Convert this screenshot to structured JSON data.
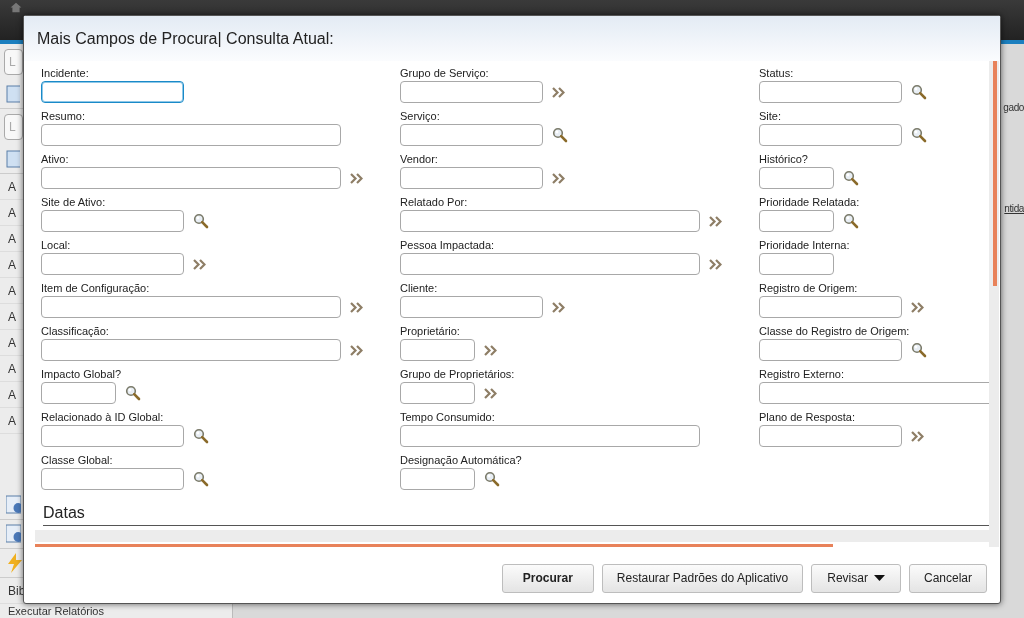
{
  "background": {
    "search_fields": [
      {
        "placeholder": "L"
      },
      {
        "placeholder": "L"
      }
    ],
    "sidebar_items": [
      "A",
      "A",
      "A",
      "A",
      "A",
      "A",
      "A",
      "A",
      "A",
      "A"
    ],
    "sidebar_links": [
      "Bib",
      "Executar Relatórios"
    ],
    "right_texts": [
      {
        "text": "gado",
        "kind": "plain"
      },
      {
        "text": "ntida",
        "kind": "link"
      }
    ]
  },
  "dialog": {
    "title": "Mais Campos de Procura| Consulta Atual:",
    "columns": [
      {
        "fields": [
          {
            "label": "Incidente:",
            "focused": true
          },
          {
            "label": "Resumo:",
            "focused": false
          },
          {
            "label": "Ativo:",
            "kind": "expand",
            "focused": false
          },
          {
            "label": "Site de Ativo:",
            "kind": "search",
            "focused": false
          },
          {
            "label": "Local:",
            "kind": "expand",
            "focused": false
          },
          {
            "label": "Item de Configuração:",
            "kind": "expand",
            "focused": false
          },
          {
            "label": "Classificação:",
            "kind": "expand",
            "focused": false
          },
          {
            "label": "Impacto Global?",
            "kind": "search",
            "focused": false
          },
          {
            "label": "Relacionado à ID Global:",
            "kind": "search",
            "focused": false
          },
          {
            "label": "Classe Global:",
            "kind": "search",
            "focused": false
          }
        ]
      },
      {
        "fields": [
          {
            "label": "Grupo de Serviço:",
            "kind": "expand",
            "focused": false
          },
          {
            "label": "Serviço:",
            "kind": "search",
            "focused": false
          },
          {
            "label": "Vendor:",
            "kind": "expand",
            "focused": false
          },
          {
            "label": "Relatado Por:",
            "kind": "expand",
            "focused": false
          },
          {
            "label": "Pessoa Impactada:",
            "kind": "expand",
            "focused": false
          },
          {
            "label": "Cliente:",
            "kind": "expand",
            "focused": false
          },
          {
            "label": "Proprietário:",
            "kind": "expand",
            "focused": false
          },
          {
            "label": "Grupo de Proprietários:",
            "kind": "expand",
            "focused": false
          },
          {
            "label": "Tempo Consumido:",
            "focused": false
          },
          {
            "label": "Designação Automática?",
            "kind": "search",
            "focused": false
          }
        ]
      },
      {
        "fields": [
          {
            "label": "Status:",
            "kind": "search",
            "focused": false
          },
          {
            "label": "Site:",
            "kind": "search",
            "focused": false
          },
          {
            "label": "Histórico?",
            "kind": "search",
            "focused": false
          },
          {
            "label": "Prioridade Relatada:",
            "kind": "search",
            "focused": false
          },
          {
            "label": "Prioridade Interna:",
            "focused": false
          },
          {
            "label": "Registro de Origem:",
            "kind": "expand",
            "focused": false
          },
          {
            "label": "Classe do Registro de Origem:",
            "kind": "search",
            "focused": false
          },
          {
            "label": "Registro Externo:",
            "focused": false
          },
          {
            "label": "Plano de Resposta:",
            "kind": "expand",
            "focused": false
          }
        ]
      }
    ],
    "section_heading": "Datas",
    "buttons": [
      {
        "label": "Procurar",
        "kind": "primary"
      },
      {
        "label": "Restaurar Padrões do Aplicativo",
        "kind": "plain"
      },
      {
        "label": "Revisar",
        "kind": "menu"
      },
      {
        "label": "Cancelar",
        "kind": "plain"
      }
    ]
  }
}
